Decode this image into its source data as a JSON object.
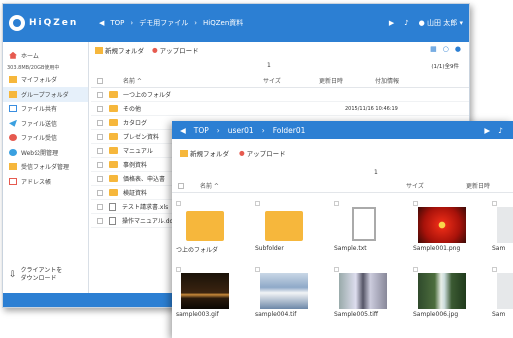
{
  "back_window": {
    "app_name": "HiQZen",
    "breadcrumb": [
      "TOP",
      "デモ用ファイル",
      "HiQZen資料"
    ],
    "user": "山田 太郎",
    "sidebar": {
      "home": "ホーム",
      "quota": "303.8MB/20GB使用中",
      "items": [
        "マイフォルダ",
        "グループフォルダ",
        "ファイル共有",
        "ファイル送信",
        "ファイル受信",
        "Web公開管理",
        "受信フォルダ管理",
        "アドレス帳"
      ],
      "bottom_label_1": "クライアントを",
      "bottom_label_2": "ダウンロード"
    },
    "toolbar": {
      "new_folder": "新規フォルダ",
      "upload": "アップロード"
    },
    "page_number": "1",
    "pagination": "(1/1)全9件",
    "columns": {
      "name": "名前",
      "size": "サイズ",
      "updated": "更新日時",
      "updater": "付加情報"
    },
    "rows": [
      {
        "name": "一つ上のフォルダ",
        "type": "folder",
        "date": ""
      },
      {
        "name": "その他",
        "type": "folder",
        "date": "2015/11/16 10:46:19"
      },
      {
        "name": "カタログ",
        "type": "folder",
        "date": ""
      },
      {
        "name": "プレゼン資料",
        "type": "folder",
        "date": ""
      },
      {
        "name": "マニュアル",
        "type": "folder",
        "date": ""
      },
      {
        "name": "事例資料",
        "type": "folder",
        "date": ""
      },
      {
        "name": "価格表、申込書",
        "type": "folder",
        "date": ""
      },
      {
        "name": "検証資料",
        "type": "folder",
        "date": ""
      },
      {
        "name": "テスト請求書.xls",
        "type": "file",
        "date": ""
      },
      {
        "name": "操作マニュアル.doc",
        "type": "file",
        "date": ""
      }
    ]
  },
  "front_window": {
    "breadcrumb": [
      "TOP",
      "user01",
      "Folder01"
    ],
    "toolbar": {
      "new_folder": "新規フォルダ",
      "upload": "アップロード"
    },
    "page_number": "1",
    "columns": {
      "name": "名前",
      "size": "サイズ",
      "updated": "更新日時"
    },
    "tiles": [
      {
        "name": "つ上のフォルダ",
        "kind": "folder"
      },
      {
        "name": "Subfolder",
        "kind": "folder"
      },
      {
        "name": "Sample.txt",
        "kind": "text"
      },
      {
        "name": "Sample001.png",
        "kind": "red-flower"
      },
      {
        "name": "Sam",
        "kind": "partial"
      },
      {
        "name": "sample003.gif",
        "kind": "dark-sunset"
      },
      {
        "name": "sample004.tif",
        "kind": "sky"
      },
      {
        "name": "Sample005.tiff",
        "kind": "station"
      },
      {
        "name": "Sample006.jpg",
        "kind": "waterfall"
      },
      {
        "name": "Sam",
        "kind": "partial"
      }
    ]
  },
  "colors": {
    "brand_blue": "#2c7fd3",
    "folder_yellow": "#f6b73c"
  }
}
